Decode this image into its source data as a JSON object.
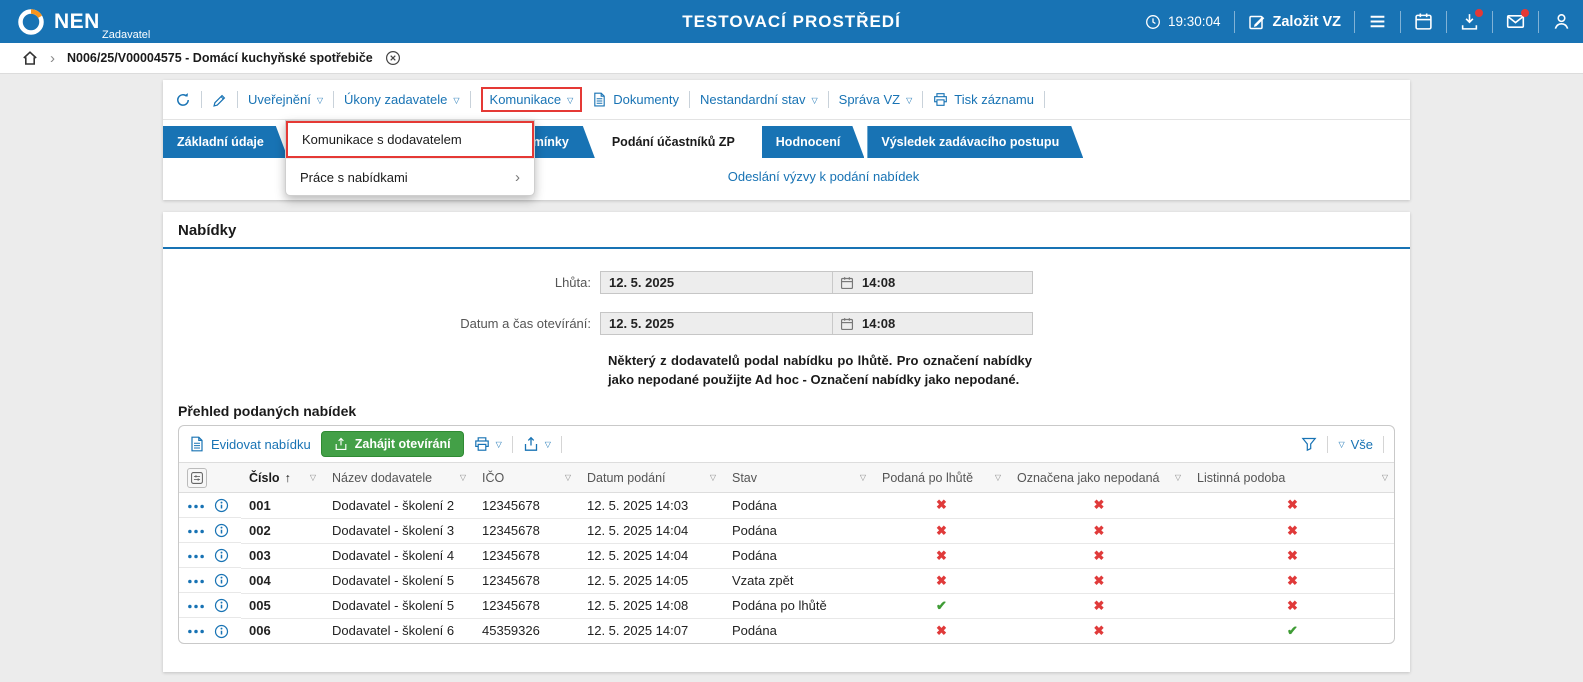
{
  "topbar": {
    "brand": "NEN",
    "brand_sub": "Zadavatel",
    "title": "TESTOVACÍ PROSTŘEDÍ",
    "time": "19:30:04",
    "create_vz_label": "Založit VZ"
  },
  "breadcrumb": {
    "record": "N006/25/V00004575 - Domácí kuchyňské spotřebiče"
  },
  "icons": {
    "caret": "▽",
    "chevron_right": "›",
    "breadcrumb_sep": "›",
    "sort_asc": "↑"
  },
  "toolbar": {
    "uverejneni": "Uveřejnění",
    "ukony": "Úkony zadavatele",
    "komunikace": "Komunikace",
    "dokumenty": "Dokumenty",
    "nestandardni": "Nestandardní stav",
    "sprava": "Správa VZ",
    "tisk": "Tisk záznamu"
  },
  "dropdown": {
    "items": [
      {
        "label": "Komunikace s dodavatelem"
      },
      {
        "label": "Práce s nabídkami"
      }
    ]
  },
  "tabs": [
    {
      "label": "Základní údaje",
      "active": false
    },
    {
      "label": "Zadávací podmínky",
      "active": false
    },
    {
      "label": "Podání účastníků ZP",
      "active": true
    },
    {
      "label": "Hodnocení",
      "active": false
    },
    {
      "label": "Výsledek zadávacího postupu",
      "active": false
    }
  ],
  "subnav": {
    "link": "Odeslání výzvy k podání nabídek"
  },
  "section": {
    "title": "Nabídky",
    "fields": [
      {
        "label": "Lhůta:",
        "date": "12. 5. 2025",
        "time": "14:08"
      },
      {
        "label": "Datum a čas otevírání:",
        "date": "12. 5. 2025",
        "time": "14:08"
      }
    ],
    "warning": "Některý z dodavatelů podal nabídku po lhůtě. Pro označení nabídky jako nepodané použijte Ad hoc - Označení nabídky jako nepodané."
  },
  "table": {
    "title": "Přehled podaných nabídek",
    "toolbar": {
      "evidovat": "Evidovat nabídku",
      "zahajit": "Zahájit otevírání",
      "vse": "Vše"
    },
    "columns": [
      "Číslo",
      "Název dodavatele",
      "IČO",
      "Datum podání",
      "Stav",
      "Podaná po lhůtě",
      "Označena jako nepodaná",
      "Listinná podoba"
    ],
    "rows": [
      {
        "cislo": "001",
        "dodavatel": "Dodavatel - školení 2",
        "ico": "12345678",
        "datum": "12. 5. 2025 14:03",
        "stav": "Podána",
        "po_lhute": "✖",
        "nepodana": "✖",
        "listinna": "✖"
      },
      {
        "cislo": "002",
        "dodavatel": "Dodavatel - školení 3",
        "ico": "12345678",
        "datum": "12. 5. 2025 14:04",
        "stav": "Podána",
        "po_lhute": "✖",
        "nepodana": "✖",
        "listinna": "✖"
      },
      {
        "cislo": "003",
        "dodavatel": "Dodavatel - školení 4",
        "ico": "12345678",
        "datum": "12. 5. 2025 14:04",
        "stav": "Podána",
        "po_lhute": "✖",
        "nepodana": "✖",
        "listinna": "✖"
      },
      {
        "cislo": "004",
        "dodavatel": "Dodavatel - školení 5",
        "ico": "12345678",
        "datum": "12. 5. 2025 14:05",
        "stav": "Vzata zpět",
        "po_lhute": "✖",
        "nepodana": "✖",
        "listinna": "✖"
      },
      {
        "cislo": "005",
        "dodavatel": "Dodavatel - školení 5",
        "ico": "12345678",
        "datum": "12. 5. 2025 14:08",
        "stav": "Podána po lhůtě",
        "po_lhute": "✔",
        "nepodana": "✖",
        "listinna": "✖"
      },
      {
        "cislo": "006",
        "dodavatel": "Dodavatel - školení 6",
        "ico": "45359326",
        "datum": "12. 5. 2025 14:07",
        "stav": "Podána",
        "po_lhute": "✖",
        "nepodana": "✖",
        "listinna": "✔"
      }
    ]
  },
  "colors": {
    "primary_blue": "#1873b4",
    "green_button": "#43a047",
    "mark_red": "#e03a3a",
    "mark_green": "#3f9c35",
    "annotation_red": "#e53935"
  }
}
